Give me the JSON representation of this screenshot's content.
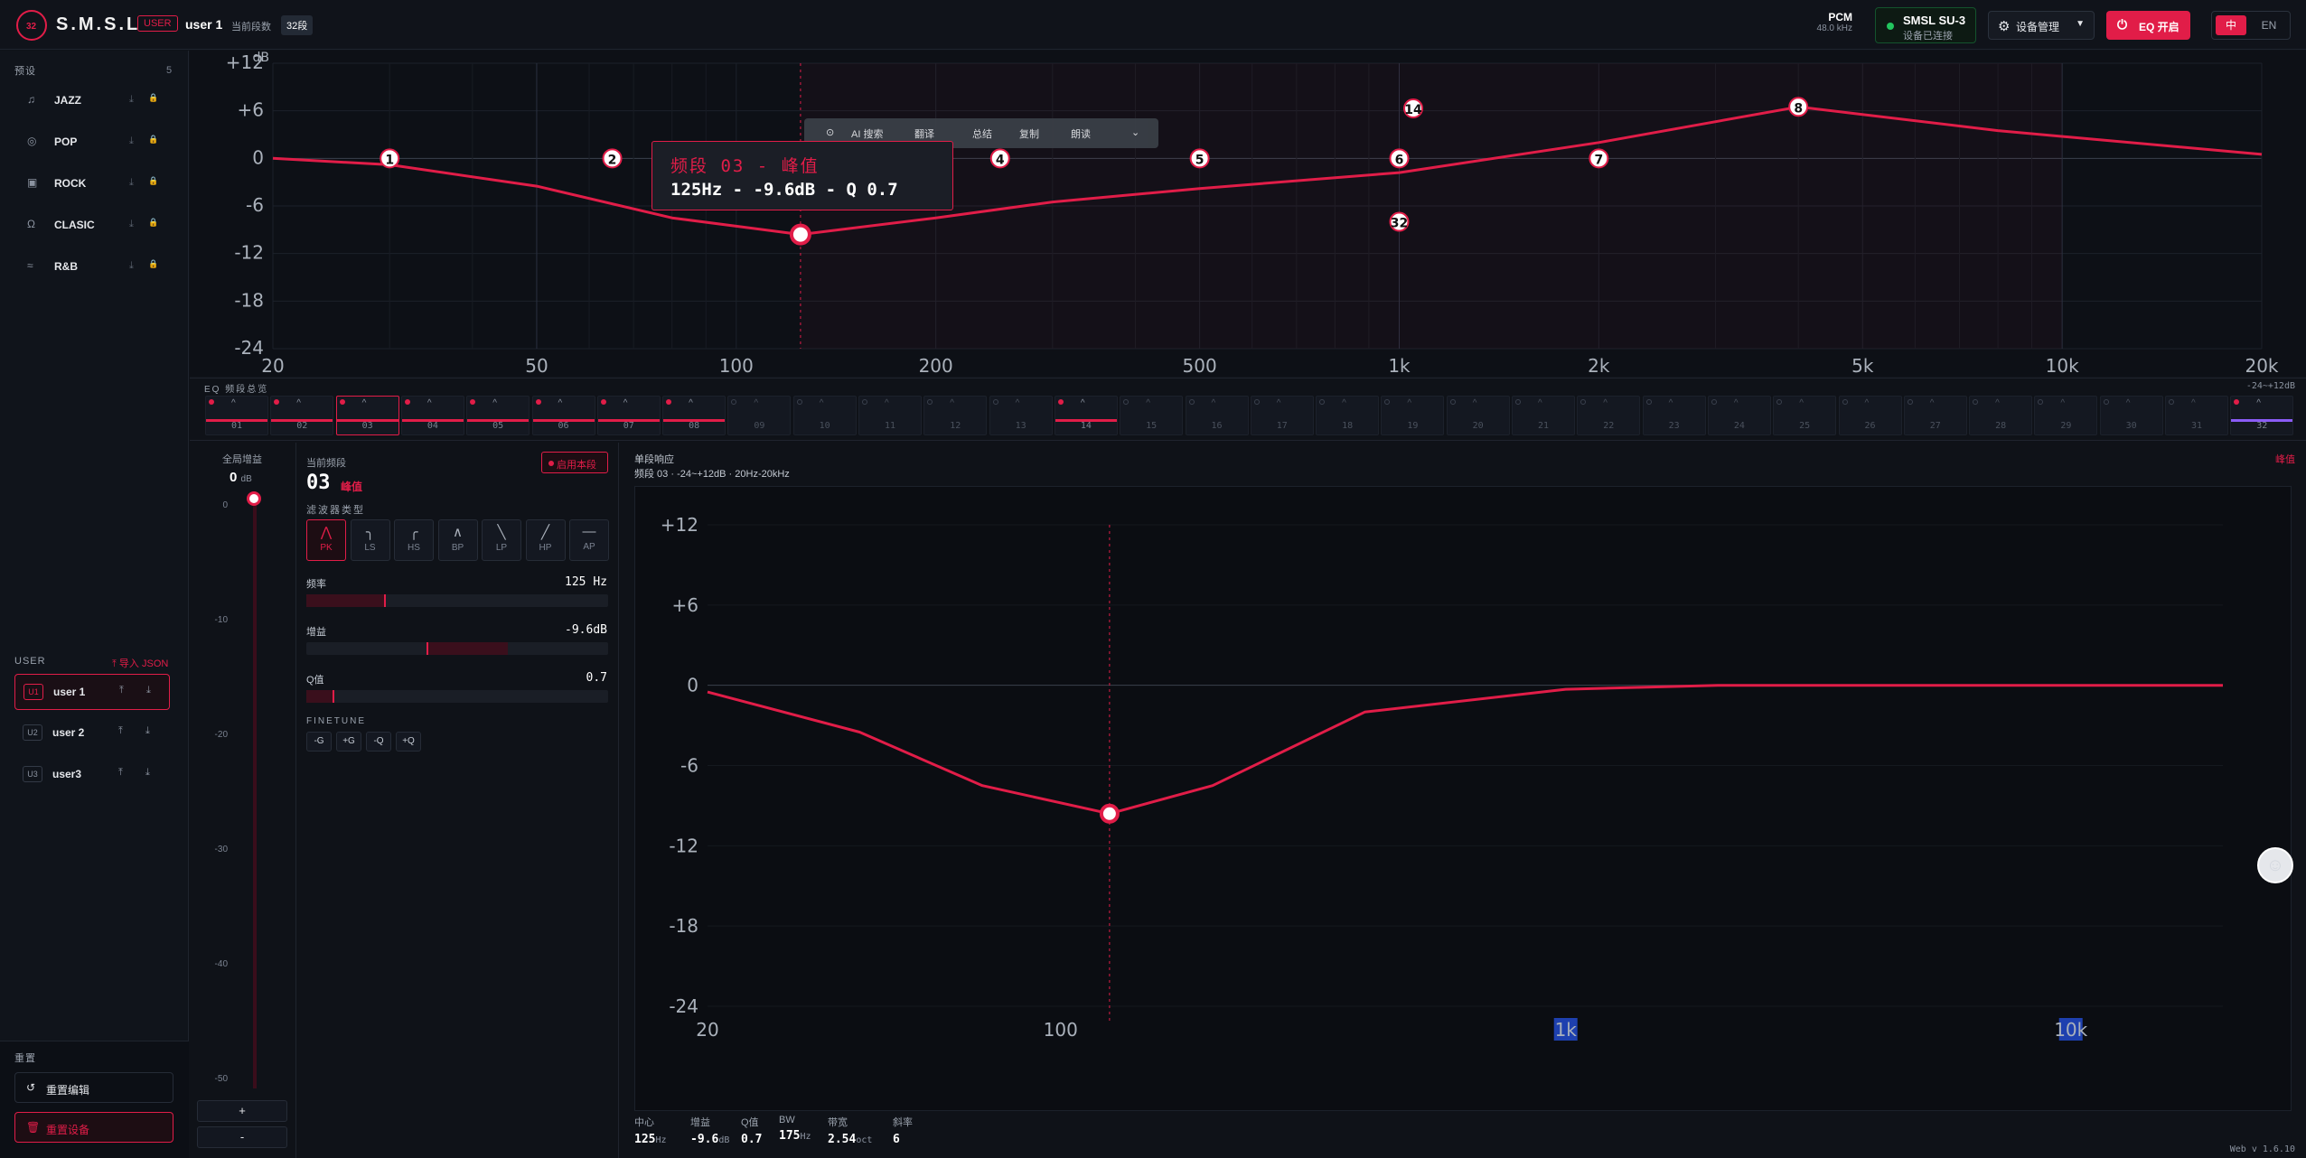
{
  "header": {
    "brand": "S.M.S.L",
    "logo_mark": "32",
    "user_badge": "USER",
    "user": "user 1",
    "seg_label": "当前段数",
    "seg_value": "32段",
    "pcm": "PCM",
    "rate": "48.0 kHz",
    "device": "SMSL SU-3",
    "device_status": "设备已连接",
    "mgmt": "设备管理",
    "eq": "EQ 开启",
    "lang_zh": "中",
    "lang_en": "EN",
    "colors": {
      "accent": "#e11d48",
      "ok": "#22c55e"
    }
  },
  "sidebar": {
    "presets_title": "预设",
    "presets_count": "5",
    "presets": [
      {
        "label": "JAZZ",
        "icon": "guitar-icon"
      },
      {
        "label": "POP",
        "icon": "disc-icon"
      },
      {
        "label": "ROCK",
        "icon": "speaker-icon"
      },
      {
        "label": "CLASIC",
        "icon": "headphones-icon"
      },
      {
        "label": "R&B",
        "icon": "wave-icon"
      }
    ],
    "user_title": "USER",
    "import": "导入 JSON",
    "users": [
      {
        "id": "U1",
        "label": "user 1",
        "selected": true
      },
      {
        "id": "U2",
        "label": "user 2",
        "selected": false
      },
      {
        "id": "U3",
        "label": "user3",
        "selected": false
      }
    ],
    "reset_title": "重置",
    "reset_edit": "重置编辑",
    "reset_device": "重置设备"
  },
  "graph": {
    "y_ticks": [
      "+12",
      "+6",
      "0",
      "-6",
      "-12",
      "-18",
      "-24"
    ],
    "x_ticks": [
      "20",
      "50",
      "100",
      "200",
      "500",
      "1k",
      "2k",
      "5k",
      "10k",
      "20k"
    ],
    "top_cut": "dB",
    "markers": [
      "1",
      "2",
      "4",
      "5",
      "6",
      "7",
      "8",
      "14",
      "32"
    ],
    "selected_marker": "03",
    "tooltip": {
      "title": "频段 03 - 峰值",
      "detail": "125Hz - -9.6dB - Q 0.7"
    },
    "toolbar": [
      "AI 搜索",
      "翻译",
      "总结",
      "复制",
      "朗读"
    ]
  },
  "chart_data": {
    "type": "line",
    "title": "",
    "xlabel": "",
    "ylabel": "",
    "x_scale": "log",
    "xlim": [
      20,
      20000
    ],
    "ylim": [
      -24,
      12
    ],
    "series": [
      {
        "name": "",
        "x": [
          20,
          30,
          50,
          80,
          125,
          200,
          300,
          500,
          1000,
          2000,
          4000,
          8000,
          20000
        ],
        "y": [
          0,
          -0.8,
          -3.5,
          -7.5,
          -9.6,
          -7.5,
          -5.5,
          -3.8,
          -1.8,
          2,
          6.5,
          3.5,
          0.5
        ]
      }
    ],
    "points": [
      {
        "label": "1",
        "x": 30,
        "y": 0
      },
      {
        "label": "2",
        "x": 65,
        "y": 0
      },
      {
        "label": "03",
        "x": 125,
        "y": -9.6
      },
      {
        "label": "4",
        "x": 250,
        "y": 0
      },
      {
        "label": "5",
        "x": 500,
        "y": 0
      },
      {
        "label": "6",
        "x": 1000,
        "y": 0
      },
      {
        "label": "7",
        "x": 2000,
        "y": 0
      },
      {
        "label": "8",
        "x": 4000,
        "y": 6.5
      },
      {
        "label": "14",
        "x": 1050,
        "y": 6.3
      },
      {
        "label": "32",
        "x": 1000,
        "y": -8
      }
    ]
  },
  "strip": {
    "title": "EQ 频段总览",
    "range": "-24~+12dB",
    "bands": [
      "01",
      "02",
      "03",
      "04",
      "05",
      "06",
      "07",
      "08",
      "09",
      "10",
      "11",
      "12",
      "13",
      "14",
      "15",
      "16",
      "17",
      "18",
      "19",
      "20",
      "21",
      "22",
      "23",
      "24",
      "25",
      "26",
      "27",
      "28",
      "29",
      "30",
      "31",
      "32"
    ],
    "active": [
      0,
      1,
      2,
      3,
      4,
      5,
      6,
      7,
      13,
      31
    ],
    "selected": 2
  },
  "gain": {
    "label": "全局增益",
    "value": "0",
    "unit": "dB",
    "ticks": [
      "0",
      "-10",
      "-20",
      "-30",
      "-40",
      "-50"
    ],
    "plus": "+",
    "minus": "-"
  },
  "editor": {
    "label": "当前频段",
    "band": "03",
    "type": "峰值",
    "enable": "启用本段",
    "filter_label": "滤波器类型",
    "filters": [
      "PK",
      "LS",
      "HS",
      "BP",
      "LP",
      "HP",
      "AP"
    ],
    "filter_selected": 0,
    "freq_label": "频率",
    "freq_value": "125 Hz",
    "gain_label": "增益",
    "gain_value": "-9.6dB",
    "q_label": "Q值",
    "q_value": "0.7",
    "fine_label": "FINETUNE",
    "fine": [
      "-G",
      "+G",
      "-Q",
      "+Q"
    ],
    "freq_pos": 0.26,
    "gain_pos": 0.4,
    "q_pos": 0.09
  },
  "response": {
    "title": "单段响应",
    "sub": "频段 03 · -24~+12dB · 20Hz-20kHz",
    "link": "峰值",
    "y_ticks": [
      "+12",
      "+6",
      "0",
      "-6",
      "-12",
      "-18",
      "-24"
    ],
    "x_ticks": [
      "20",
      "100",
      "1k",
      "10k"
    ],
    "stats": [
      {
        "k": "中心",
        "v": "125",
        "u": "Hz"
      },
      {
        "k": "增益",
        "v": "-9.6",
        "u": "dB"
      },
      {
        "k": "Q值",
        "v": "0.7",
        "u": ""
      },
      {
        "k": "BW",
        "v": "175",
        "u": "Hz"
      },
      {
        "k": "带宽",
        "v": "2.54",
        "u": "oct"
      },
      {
        "k": "斜率",
        "v": "6",
        "u": ""
      }
    ],
    "version": "Web v 1.6.10"
  },
  "chart_data_2": {
    "type": "line",
    "x_scale": "log",
    "xlim": [
      20,
      20000
    ],
    "ylim": [
      -24,
      12
    ],
    "x": [
      20,
      40,
      70,
      125,
      200,
      400,
      1000,
      2000,
      20000
    ],
    "y": [
      -0.5,
      -3.5,
      -7.5,
      -9.6,
      -7.5,
      -2,
      -0.3,
      0,
      0
    ]
  }
}
